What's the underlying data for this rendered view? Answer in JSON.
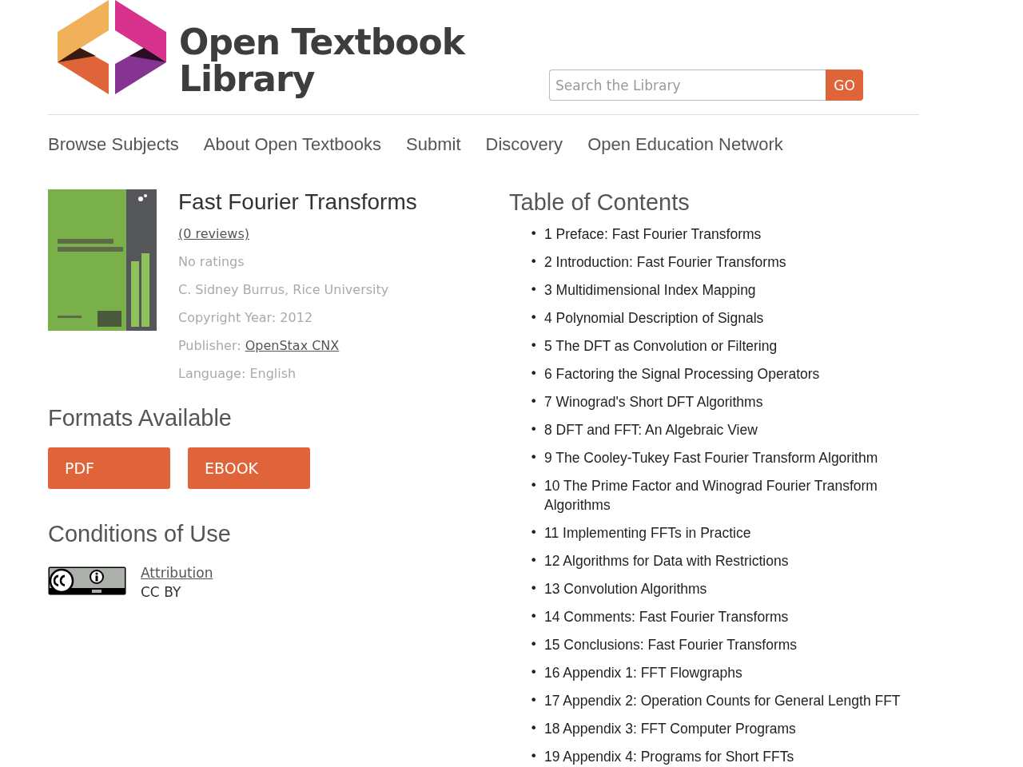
{
  "header": {
    "logo_line_1": "Open Textbook",
    "logo_line_2": "Library",
    "search": {
      "placeholder": "Search the Library",
      "button": "GO"
    }
  },
  "nav": [
    "Browse Subjects",
    "About Open Textbooks",
    "Submit",
    "Discovery",
    "Open Education Network"
  ],
  "book": {
    "title": "Fast Fourier Transforms",
    "reviews": "(0 reviews)",
    "ratings": "No ratings",
    "author": "C. Sidney Burrus, Rice University",
    "copyright": "Copyright Year: 2012",
    "publisher_label": "Publisher:",
    "publisher": "OpenStax CNX",
    "language": "Language: English"
  },
  "formats": {
    "heading": "Formats Available",
    "buttons": [
      "PDF",
      "EBOOK"
    ]
  },
  "conditions": {
    "heading": "Conditions of Use",
    "license_link": "Attribution",
    "license": "CC BY"
  },
  "toc": {
    "heading": "Table of Contents",
    "bullet": "•",
    "items": [
      "1 Preface: Fast Fourier Transforms",
      "2 Introduction: Fast Fourier Transforms",
      "3 Multidimensional Index Mapping",
      "4 Polynomial Description of Signals",
      "5 The DFT as Convolution or Filtering",
      "6 Factoring the Signal Processing Operators",
      "7 Winograd's Short DFT Algorithms",
      "8 DFT and FFT: An Algebraic View",
      "9 The Cooley-Tukey Fast Fourier Transform Algorithm",
      "10 The Prime Factor and Winograd Fourier Transform Algorithms",
      "11 Implementing FFTs in Practice",
      "12 Algorithms for Data with Restrictions",
      "13 Convolution Algorithms",
      "14 Comments: Fast Fourier Transforms",
      "15 Conclusions: Fast Fourier Transforms",
      "16 Appendix 1: FFT Flowgraphs",
      "17 Appendix 2: Operation Counts for General Length FFT",
      "18 Appendix 3: FFT Computer Programs",
      "19 Appendix 4: Programs for Short FFTs"
    ]
  }
}
